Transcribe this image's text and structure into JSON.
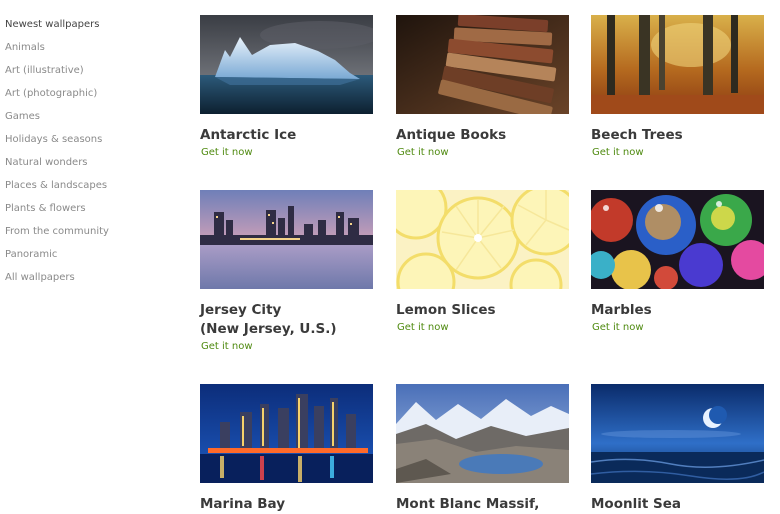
{
  "sidebar": {
    "items": [
      {
        "label": "Newest wallpapers",
        "active": true
      },
      {
        "label": "Animals"
      },
      {
        "label": "Art (illustrative)"
      },
      {
        "label": "Art (photographic)"
      },
      {
        "label": "Games"
      },
      {
        "label": "Holidays & seasons"
      },
      {
        "label": "Natural wonders"
      },
      {
        "label": "Places & landscapes"
      },
      {
        "label": "Plants & flowers"
      },
      {
        "label": "From the community"
      },
      {
        "label": "Panoramic"
      },
      {
        "label": "All wallpapers"
      }
    ]
  },
  "wallpapers": [
    {
      "title": "Antarctic Ice",
      "link": "Get it now"
    },
    {
      "title": "Antique Books",
      "link": "Get it now"
    },
    {
      "title": "Beech Trees",
      "link": "Get it now"
    },
    {
      "title": "Jersey City",
      "title_line2": "(New Jersey, U.S.)",
      "link": "Get it now"
    },
    {
      "title": "Lemon Slices",
      "link": "Get it now"
    },
    {
      "title": "Marbles",
      "link": "Get it now"
    },
    {
      "title": "Marina Bay"
    },
    {
      "title": "Mont Blanc Massif,"
    },
    {
      "title": "Moonlit Sea"
    }
  ],
  "colors": {
    "link": "#4f8a10",
    "title": "#3a3a3a",
    "nav": "#8a8a8a",
    "nav_active": "#444444"
  }
}
